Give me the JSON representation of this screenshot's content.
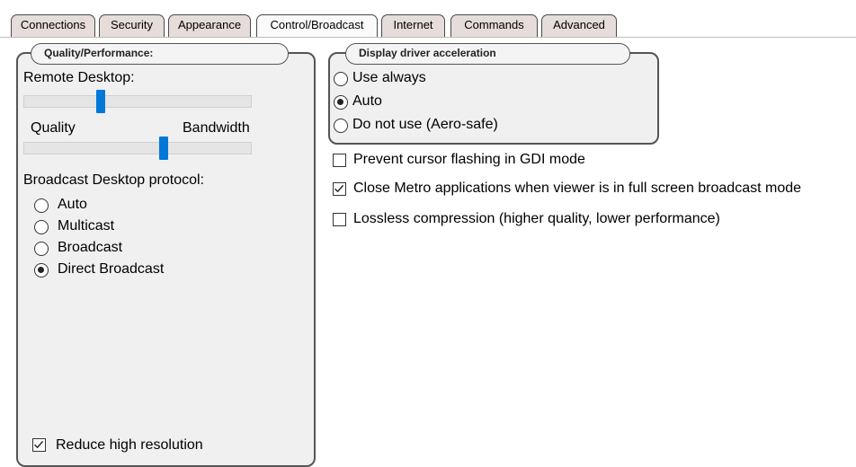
{
  "tabs": [
    {
      "label": "Connections",
      "active": false
    },
    {
      "label": "Security",
      "active": false
    },
    {
      "label": "Appearance",
      "active": false
    },
    {
      "label": "Control/Broadcast",
      "active": true
    },
    {
      "label": "Internet",
      "active": false
    },
    {
      "label": "Commands",
      "active": false
    },
    {
      "label": "Advanced",
      "active": false
    }
  ],
  "quality_group": {
    "title": "Quality/Performance:",
    "remote_desktop_label": "Remote Desktop:",
    "quality_label": "Quality",
    "bandwidth_label": "Bandwidth",
    "remote_desktop_slider_fraction": 0.33,
    "quality_bandwidth_slider_fraction": 0.62,
    "protocol_label": "Broadcast Desktop protocol:",
    "protocol_options": [
      {
        "label": "Auto",
        "selected": false
      },
      {
        "label": "Multicast",
        "selected": false
      },
      {
        "label": "Broadcast",
        "selected": false
      },
      {
        "label": "Direct Broadcast",
        "selected": true
      }
    ],
    "reduce_high_resolution": {
      "label": "Reduce high resolution",
      "checked": true
    }
  },
  "display_group": {
    "title": "Display driver acceleration",
    "options": [
      {
        "label": "Use always",
        "selected": false
      },
      {
        "label": "Auto",
        "selected": true
      },
      {
        "label": "Do not use (Aero-safe)",
        "selected": false
      }
    ]
  },
  "checkboxes": [
    {
      "label": "Prevent cursor flashing in GDI mode",
      "checked": false
    },
    {
      "label": "Close Metro applications when viewer is in full screen broadcast mode",
      "checked": true
    },
    {
      "label": "Lossless compression (higher quality, lower performance)",
      "checked": false
    }
  ],
  "colors": {
    "slider_thumb": "#0078d7",
    "tab_inactive": "#e6dcd9",
    "tab_active": "#fafafa"
  }
}
